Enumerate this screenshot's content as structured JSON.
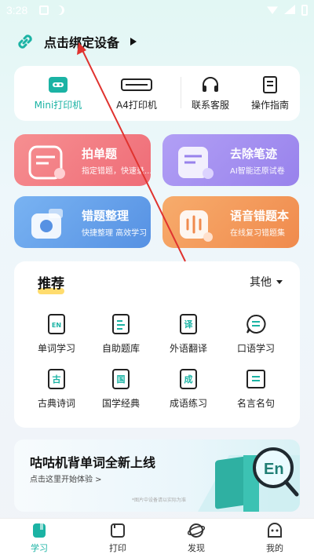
{
  "status": {
    "time": "3:28"
  },
  "bind": {
    "label": "点击绑定设备"
  },
  "printers": [
    {
      "label": "Mini打印机"
    },
    {
      "label": "A4打印机"
    },
    {
      "label": "联系客服"
    },
    {
      "label": "操作指南"
    }
  ],
  "tiles": [
    {
      "title": "拍单题",
      "sub": "指定错题，快速录...",
      "color": "#f0787e"
    },
    {
      "title": "去除笔迹",
      "sub": "AI智能还原试卷",
      "color": "#a28ef0"
    },
    {
      "title": "错题整理",
      "sub": "快捷整理 高效学习",
      "color": "#5f9de8"
    },
    {
      "title": "语音错题本",
      "sub": "在线复习错题集",
      "color": "#f49a5a"
    }
  ],
  "recommend": {
    "title": "推荐",
    "more": "其他",
    "items": [
      {
        "label": "单词学习",
        "icon": "word-icon",
        "glyph": "EN"
      },
      {
        "label": "自助题库",
        "icon": "question-bank-icon",
        "glyph": ""
      },
      {
        "label": "外语翻译",
        "icon": "translate-icon",
        "glyph": "译"
      },
      {
        "label": "口语学习",
        "icon": "speech-bubble-icon",
        "glyph": ""
      },
      {
        "label": "古典诗词",
        "icon": "poetry-icon",
        "glyph": "古"
      },
      {
        "label": "国学经典",
        "icon": "classics-icon",
        "glyph": "国"
      },
      {
        "label": "成语练习",
        "icon": "idiom-icon",
        "glyph": "成"
      },
      {
        "label": "名言名句",
        "icon": "quote-icon",
        "glyph": ""
      }
    ]
  },
  "banner": {
    "title": "咕咕机背单词全新上线",
    "sub": "点击这里开始体验 >",
    "note": "*图片中设备请以实际为准",
    "art_text": "En"
  },
  "tabs": [
    {
      "label": "学习",
      "active": true
    },
    {
      "label": "打印",
      "active": false
    },
    {
      "label": "发现",
      "active": false
    },
    {
      "label": "我的",
      "active": false
    }
  ],
  "colors": {
    "accent": "#1bb3a4",
    "text": "#222222"
  }
}
